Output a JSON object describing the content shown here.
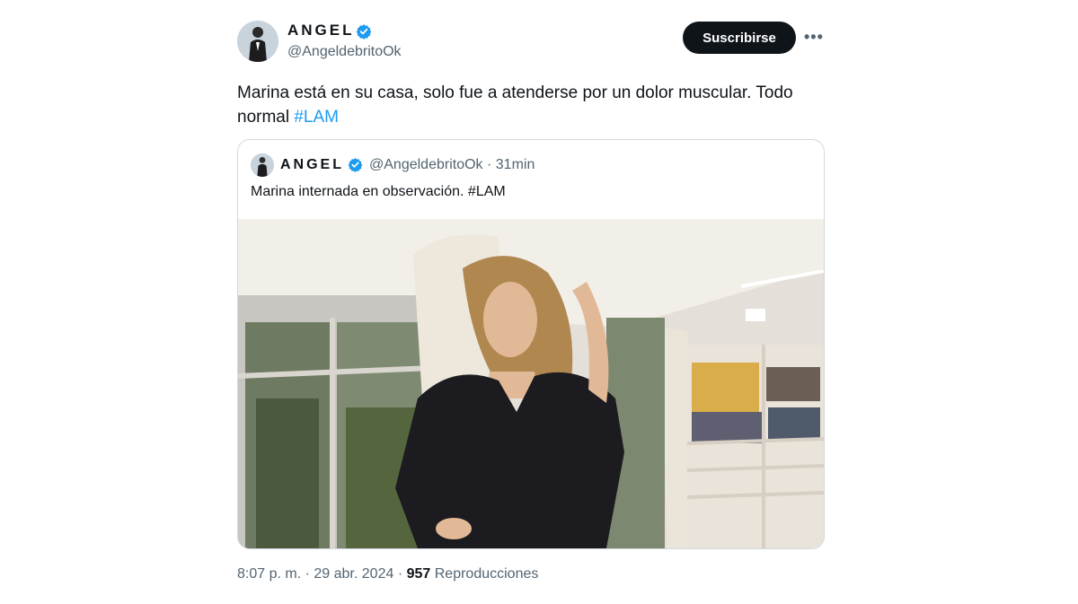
{
  "author": {
    "name": "ANGEL",
    "handle": "@AngeldebritoOk"
  },
  "actions": {
    "subscribe_label": "Suscribirse",
    "more_label": "•••"
  },
  "tweet": {
    "text": "Marina está en su casa, solo fue a atenderse por un dolor muscular. Todo normal ",
    "hashtag": "#LAM"
  },
  "quoted": {
    "name": "ANGEL",
    "handle": "@AngeldebritoOk",
    "separator": "·",
    "time": "31min",
    "text": "Marina internada en observación. #LAM"
  },
  "footer": {
    "time": "8:07 p. m.",
    "separator": "·",
    "date": "29 abr. 2024",
    "views": "957",
    "views_label": "Reproducciones"
  },
  "colors": {
    "accent": "#1d9bf0",
    "button": "#0f1419",
    "secondary_text": "#536471"
  }
}
